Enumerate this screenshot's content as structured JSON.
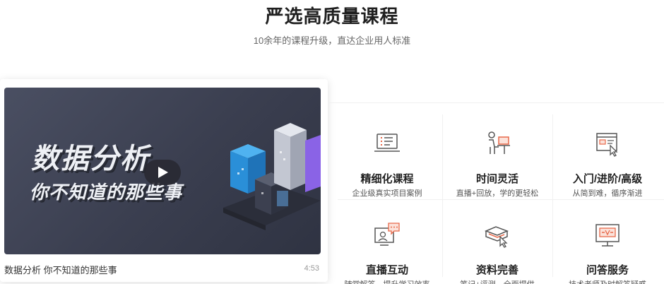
{
  "section": {
    "title": "严选高质量课程",
    "subtitle": "10余年的课程升级，直达企业用人标准"
  },
  "video": {
    "thumb_line1": "数据分析",
    "thumb_line2": "你不知道的那些事",
    "caption": "数据分析 你不知道的那些事",
    "duration": "4:53",
    "icon": "play-icon"
  },
  "features": [
    {
      "name": "精细化课程",
      "desc": "企业级真实项目案例",
      "icon": "laptop-checklist-icon"
    },
    {
      "name": "时间灵活",
      "desc": "直播+回放，学的更轻松",
      "icon": "person-at-desk-icon"
    },
    {
      "name": "入门/进阶/高级",
      "desc": "从简到难，循序渐进",
      "icon": "web-click-icon"
    },
    {
      "name": "直播互动",
      "desc": "随堂解答，提升学习效率",
      "icon": "live-chat-icon"
    },
    {
      "name": "资料完善",
      "desc": "笔记+评测，全面提供",
      "icon": "book-cursor-icon"
    },
    {
      "name": "问答服务",
      "desc": "技术老师及时解答疑惑",
      "icon": "qa-board-icon"
    }
  ],
  "colors": {
    "accent": "#e8694a",
    "icon_stroke": "#555555",
    "thumb_bg": "#3e4253"
  }
}
